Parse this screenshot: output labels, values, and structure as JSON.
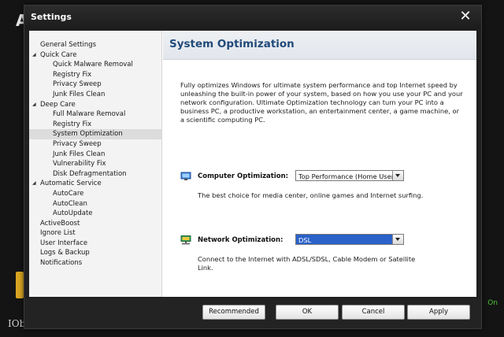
{
  "background": {
    "app_letter": "A",
    "brand_text": "IOb",
    "status_text": "On"
  },
  "dialog": {
    "title": "Settings",
    "close_glyph": "✕"
  },
  "sidebar": {
    "items": [
      {
        "label": "General Settings",
        "level": 0,
        "expandable": false
      },
      {
        "label": "Quick Care",
        "level": 0,
        "expandable": true
      },
      {
        "label": "Quick Malware Removal",
        "level": 1
      },
      {
        "label": "Registry Fix",
        "level": 1
      },
      {
        "label": "Privacy Sweep",
        "level": 1
      },
      {
        "label": "Junk Files Clean",
        "level": 1
      },
      {
        "label": "Deep Care",
        "level": 0,
        "expandable": true
      },
      {
        "label": "Full Malware Removal",
        "level": 1
      },
      {
        "label": "Registry Fix",
        "level": 1
      },
      {
        "label": "System Optimization",
        "level": 1,
        "selected": true
      },
      {
        "label": "Privacy Sweep",
        "level": 1
      },
      {
        "label": "Junk Files Clean",
        "level": 1
      },
      {
        "label": "Vulnerability Fix",
        "level": 1
      },
      {
        "label": "Disk Defragmentation",
        "level": 1
      },
      {
        "label": "Automatic Service",
        "level": 0,
        "expandable": true
      },
      {
        "label": "AutoCare",
        "level": 1
      },
      {
        "label": "AutoClean",
        "level": 1
      },
      {
        "label": "AutoUpdate",
        "level": 1
      },
      {
        "label": "ActiveBoost",
        "level": 0
      },
      {
        "label": "Ignore List",
        "level": 0
      },
      {
        "label": "User Interface",
        "level": 0
      },
      {
        "label": "Logs & Backup",
        "level": 0
      },
      {
        "label": "Notifications",
        "level": 0
      }
    ]
  },
  "main": {
    "title": "System Optimization",
    "description": "Fully optimizes Windows for ultimate system performance and top Internet speed by unleashing the built-in power of your system, based on how you use your PC and your network configuration. Ultimate Optimization technology can turn your PC into a business PC, a productive workstation, an entertainment center, a game machine, or a scientific computing PC.",
    "computer": {
      "label": "Computer Optimization:",
      "value": "Top Performance (Home User)",
      "description": "The best choice for media center, online games and Internet surfing."
    },
    "network": {
      "label": "Network Optimization:",
      "value": "DSL",
      "description": "Connect to the Internet with ADSL/SDSL, Cable Modem or Satellite Link."
    }
  },
  "footer": {
    "recommended": "Recommended",
    "ok": "OK",
    "cancel": "Cancel",
    "apply": "Apply"
  },
  "colors": {
    "title_blue": "#214a7a",
    "selection_blue": "#2a62c9",
    "accent_yellow": "#d9a521",
    "status_green": "#4fc23a"
  },
  "icons": {
    "computer_optimization": "monitor-icon",
    "network_optimization": "network-icon",
    "close": "close-icon",
    "expand": "triangle-down-icon",
    "dropdown": "chevron-down-icon"
  }
}
